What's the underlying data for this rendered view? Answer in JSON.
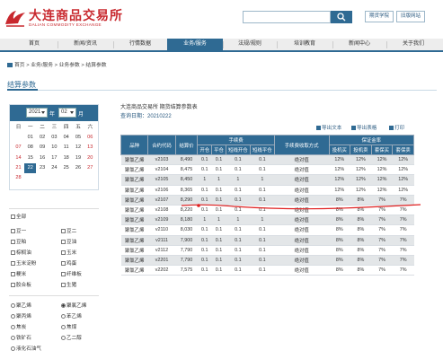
{
  "header": {
    "logo_cn": "大连商品交易所",
    "logo_en": "DALIAN COMMODITY EXCHANGE",
    "search_placeholder": "",
    "btn_1": "期货学院",
    "btn_2": "旧版网站"
  },
  "nav": [
    "首页",
    "新闻/资讯",
    "行情数据",
    "业务/服务",
    "法规/规则",
    "培训教育",
    "新闻中心",
    "关于我们"
  ],
  "nav_active": 3,
  "breadcrumb": "首页 > 业务/服务 > 业务参数 > 结算参数",
  "page_title": "结算参数",
  "calendar": {
    "year": "2021",
    "year_label": "年",
    "month": "02",
    "month_label": "月",
    "weekdays": [
      "日",
      "一",
      "二",
      "三",
      "四",
      "五",
      "六"
    ],
    "rows": [
      [
        "",
        "01",
        "02",
        "03",
        "04",
        "05",
        "06"
      ],
      [
        "07",
        "08",
        "09",
        "10",
        "11",
        "12",
        "13"
      ],
      [
        "14",
        "15",
        "16",
        "17",
        "18",
        "19",
        "20"
      ],
      [
        "21",
        "22",
        "23",
        "24",
        "25",
        "26",
        "27"
      ],
      [
        "28",
        "",
        "",
        "",
        "",
        "",
        ""
      ]
    ],
    "selected": "22"
  },
  "filters": {
    "all_label": "全部",
    "checks": [
      [
        "豆一",
        "豆二"
      ],
      [
        "豆粕",
        "豆油"
      ],
      [
        "棕榈油",
        "玉米"
      ],
      [
        "玉米淀粉",
        "鸡蛋"
      ],
      [
        "粳米",
        "纤维板"
      ],
      [
        "胶合板",
        "生猪"
      ]
    ],
    "radios": [
      [
        "聚乙烯",
        "聚氯乙烯"
      ],
      [
        "聚丙烯",
        "苯乙烯"
      ],
      [
        "焦炭",
        "焦煤"
      ],
      [
        "铁矿石",
        "乙二醇"
      ],
      [
        "液化石油气",
        ""
      ]
    ],
    "radio_selected": "聚氯乙烯"
  },
  "right": {
    "title": "大连商品交易所 期货结算参数表",
    "date": "查询日期：20210222",
    "tools": [
      "导出文本",
      "导出表格",
      "打印"
    ]
  },
  "table": {
    "headers_top": [
      "品种",
      "合约代码",
      "结算价",
      "手续费",
      "手续费收取方式",
      "保证金率"
    ],
    "headers_fee": [
      "开仓",
      "平仓",
      "短线开仓",
      "短线平仓"
    ],
    "headers_margin": [
      "投机买",
      "投机卖",
      "套保买",
      "套保卖"
    ],
    "rows": [
      [
        "聚氯乙烯",
        "v2103",
        "8,490",
        "0.1",
        "0.1",
        "0.1",
        "0.1",
        "绝对值",
        "12%",
        "12%",
        "12%",
        "12%"
      ],
      [
        "聚氯乙烯",
        "v2104",
        "8,475",
        "0.1",
        "0.1",
        "0.1",
        "0.1",
        "绝对值",
        "12%",
        "12%",
        "12%",
        "12%"
      ],
      [
        "聚氯乙烯",
        "v2105",
        "8,450",
        "1",
        "1",
        "1",
        "1",
        "绝对值",
        "12%",
        "12%",
        "12%",
        "12%"
      ],
      [
        "聚氯乙烯",
        "v2106",
        "8,365",
        "0.1",
        "0.1",
        "0.1",
        "0.1",
        "绝对值",
        "12%",
        "12%",
        "12%",
        "12%"
      ],
      [
        "聚氯乙烯",
        "v2107",
        "8,290",
        "0.1",
        "0.1",
        "0.1",
        "0.1",
        "绝对值",
        "8%",
        "8%",
        "7%",
        "7%"
      ],
      [
        "聚氯乙烯",
        "v2108",
        "8,220",
        "0.1",
        "0.1",
        "0.1",
        "0.1",
        "绝对值",
        "8%",
        "8%",
        "7%",
        "7%"
      ],
      [
        "聚氯乙烯",
        "v2109",
        "8,180",
        "1",
        "1",
        "1",
        "1",
        "绝对值",
        "8%",
        "8%",
        "7%",
        "7%"
      ],
      [
        "聚氯乙烯",
        "v2110",
        "8,030",
        "0.1",
        "0.1",
        "0.1",
        "0.1",
        "绝对值",
        "8%",
        "8%",
        "7%",
        "7%"
      ],
      [
        "聚氯乙烯",
        "v2111",
        "7,900",
        "0.1",
        "0.1",
        "0.1",
        "0.1",
        "绝对值",
        "8%",
        "8%",
        "7%",
        "7%"
      ],
      [
        "聚氯乙烯",
        "v2112",
        "7,790",
        "0.1",
        "0.1",
        "0.1",
        "0.1",
        "绝对值",
        "8%",
        "8%",
        "7%",
        "7%"
      ],
      [
        "聚氯乙烯",
        "v2201",
        "7,790",
        "0.1",
        "0.1",
        "0.1",
        "0.1",
        "绝对值",
        "8%",
        "8%",
        "7%",
        "7%"
      ],
      [
        "聚氯乙烯",
        "v2202",
        "7,575",
        "0.1",
        "0.1",
        "0.1",
        "0.1",
        "绝对值",
        "8%",
        "8%",
        "7%",
        "7%"
      ]
    ]
  },
  "colors": {
    "accent": "#2f6a93",
    "brand_red": "#c8282e",
    "annotation_red": "#e02020"
  }
}
